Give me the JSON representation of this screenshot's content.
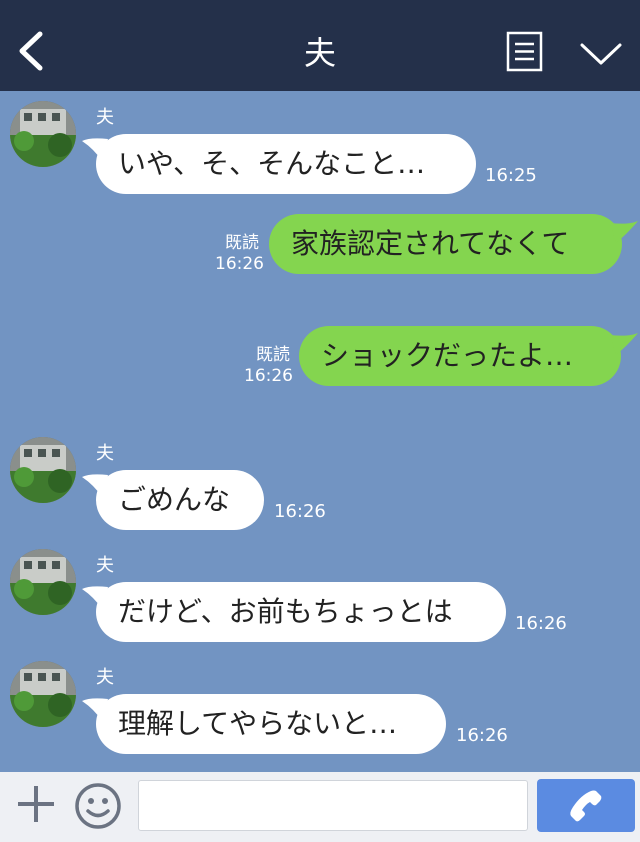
{
  "header": {
    "title": "夫"
  },
  "messages": [
    {
      "side": "in",
      "sender": "夫",
      "text": "いや、そ、そんなこと…",
      "time": "16:25"
    },
    {
      "side": "out",
      "read": "既読",
      "text": "家族認定されてなくて",
      "time": "16:26"
    },
    {
      "side": "out",
      "read": "既読",
      "text": "ショックだったよ…",
      "time": "16:26"
    },
    {
      "side": "in",
      "sender": "夫",
      "text": "ごめんな",
      "time": "16:26"
    },
    {
      "side": "in",
      "sender": "夫",
      "text": "だけど、お前もちょっとは",
      "time": "16:26"
    },
    {
      "side": "in",
      "sender": "夫",
      "text": "理解してやらないと…",
      "time": "16:26"
    }
  ],
  "footer": {
    "input_value": "",
    "input_placeholder": ""
  },
  "colors": {
    "header_bg": "#24304a",
    "chat_bg": "#7294c2",
    "outgoing_bubble": "#84d54f",
    "incoming_bubble": "#ffffff",
    "call_button": "#5b8be1"
  },
  "icons": [
    "back-icon",
    "menu-icon",
    "chevron-down-icon",
    "plus-icon",
    "smile-icon",
    "phone-icon"
  ]
}
